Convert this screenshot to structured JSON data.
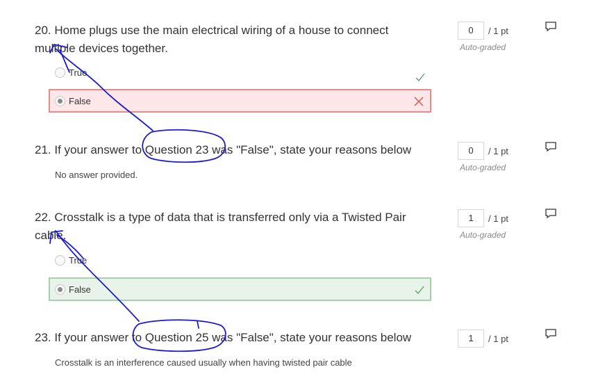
{
  "colors": {
    "wrong_border": "#e88a8a",
    "wrong_bg": "#fde7e9",
    "right_border": "#a5cfae",
    "right_bg": "#e8f3ea",
    "check": "#5aa46a",
    "cross": "#d9534f",
    "ink": "#1a1ad6"
  },
  "questions": [
    {
      "title": "20. Home plugs use the main electrical wiring of a house to connect multiple devices together.",
      "options": [
        "True",
        "False"
      ],
      "selected": "False",
      "score": "0",
      "out_of": "/ 1 pt",
      "grading": "Auto-graded"
    },
    {
      "title": "21. If your answer to Question 23 was \"False\", state your reasons below",
      "answer": "No answer provided.",
      "score": "0",
      "out_of": "/ 1 pt",
      "grading": "Auto-graded"
    },
    {
      "title": "22. Crosstalk is a type of data that is transferred only via a Twisted Pair cable.",
      "options": [
        "True",
        "False"
      ],
      "selected": "False",
      "score": "1",
      "out_of": "/ 1 pt",
      "grading": "Auto-graded"
    },
    {
      "title": "23. If your answer to Question 25 was \"False\", state your reasons below",
      "answer": "Crosstalk is an interference caused usually when having twisted pair cable",
      "score": "1",
      "out_of": "/ 1 pt"
    }
  ]
}
